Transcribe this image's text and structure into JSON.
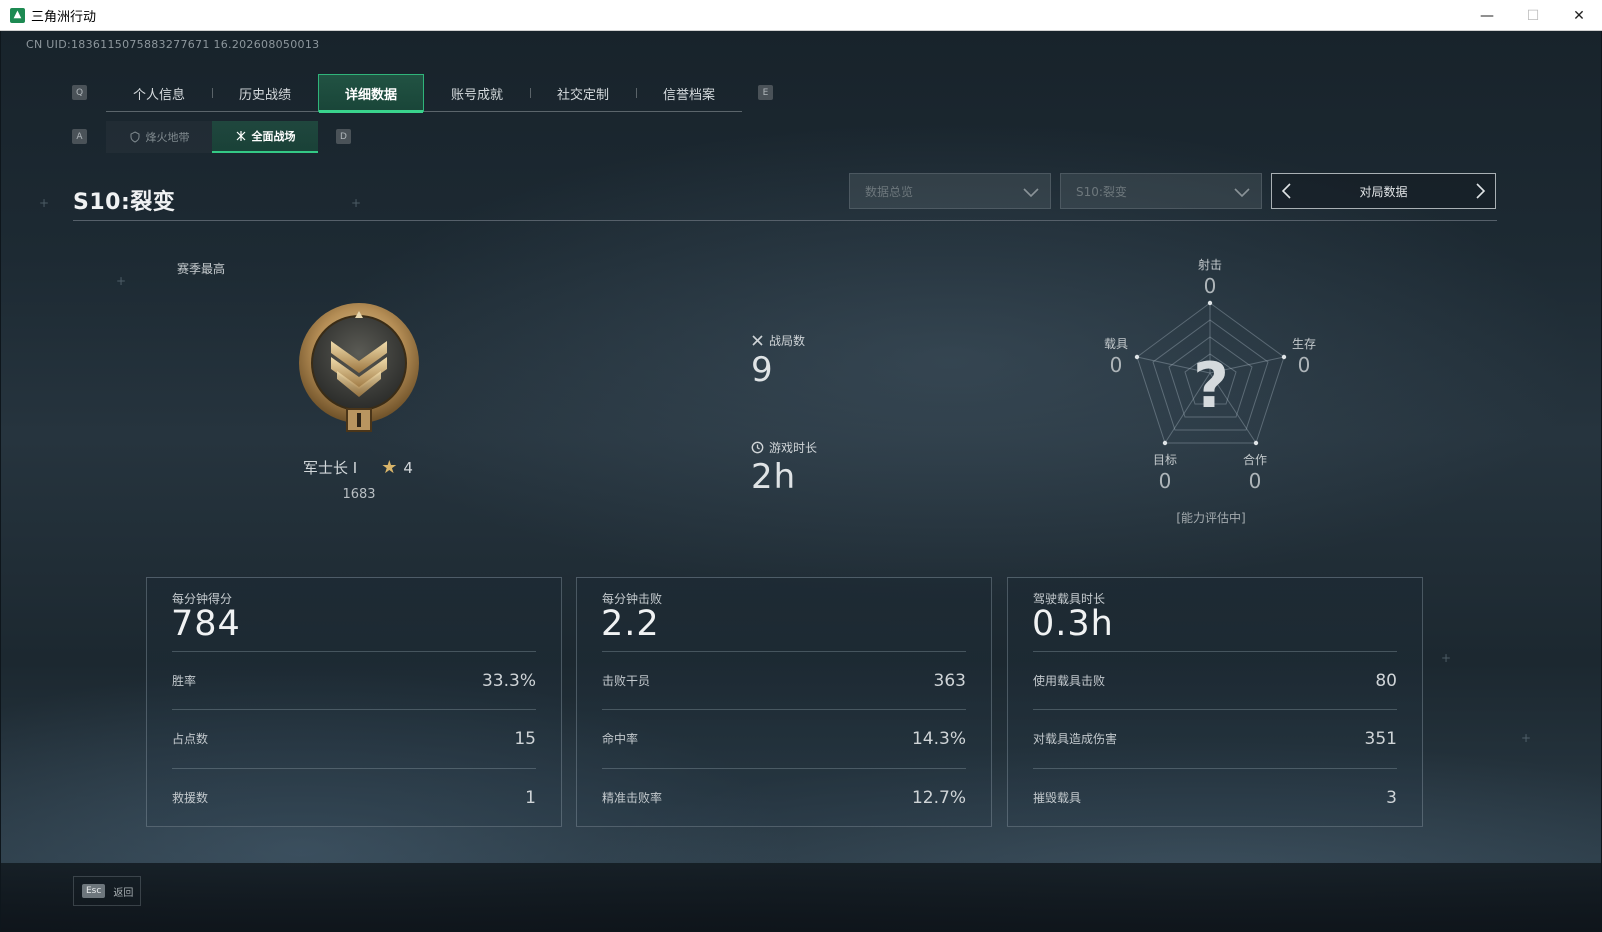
{
  "window": {
    "title": "三角洲行动",
    "minimize": "—",
    "maximize": "☐",
    "close": "✕"
  },
  "uid": "CN UID:1836115075883277671 16.202608050013",
  "main_tabs": {
    "left_key": "Q",
    "right_key": "E",
    "items": [
      {
        "label": "个人信息"
      },
      {
        "label": "历史战绩"
      },
      {
        "label": "详细数据",
        "active": true
      },
      {
        "label": "账号成就"
      },
      {
        "label": "社交定制"
      },
      {
        "label": "信誉档案"
      }
    ]
  },
  "sub_tabs": {
    "left_key": "A",
    "right_key": "D",
    "items": [
      {
        "label": "烽火地带",
        "icon": "shield-outline-icon"
      },
      {
        "label": "全面战场",
        "icon": "crossed-arrows-icon",
        "active": true
      }
    ]
  },
  "season": {
    "title": "S10:裂变"
  },
  "filters": {
    "dropdown1": "数据总览",
    "dropdown2": "S10:裂变",
    "pager_label": "对局数据"
  },
  "rank": {
    "label": "赛季最高",
    "name": "军士长 I",
    "stars": "4",
    "score": "1683"
  },
  "center_stats": {
    "matches_label": "战局数",
    "matches_value": "9",
    "playtime_label": "游戏时长",
    "playtime_value": "2h"
  },
  "radar": {
    "shooting_label": "射击",
    "shooting_value": "0",
    "survival_label": "生存",
    "survival_value": "0",
    "coop_label": "合作",
    "coop_value": "0",
    "objective_label": "目标",
    "objective_value": "0",
    "vehicle_label": "载具",
    "vehicle_value": "0",
    "unknown_mark": "?",
    "evaluating": "[能力评估中]"
  },
  "cards": [
    {
      "head_label": "每分钟得分",
      "head_value": "784",
      "rows": [
        {
          "label": "胜率",
          "value": "33.3%"
        },
        {
          "label": "占点数",
          "value": "15"
        },
        {
          "label": "救援数",
          "value": "1"
        }
      ]
    },
    {
      "head_label": "每分钟击败",
      "head_value": "2.2",
      "rows": [
        {
          "label": "击败干员",
          "value": "363"
        },
        {
          "label": "命中率",
          "value": "14.3%"
        },
        {
          "label": "精准击败率",
          "value": "12.7%"
        }
      ]
    },
    {
      "head_label": "驾驶载具时长",
      "head_value": "0.3h",
      "rows": [
        {
          "label": "使用载具击败",
          "value": "80"
        },
        {
          "label": "对载具造成伤害",
          "value": "351"
        },
        {
          "label": "摧毁载具",
          "value": "3"
        }
      ]
    }
  ],
  "footer": {
    "esc_key": "Esc",
    "back_label": "返回"
  },
  "colors": {
    "accent": "#2fb47a",
    "accent_bright": "#3ad48d",
    "rank_gold": "#d9b56a"
  }
}
